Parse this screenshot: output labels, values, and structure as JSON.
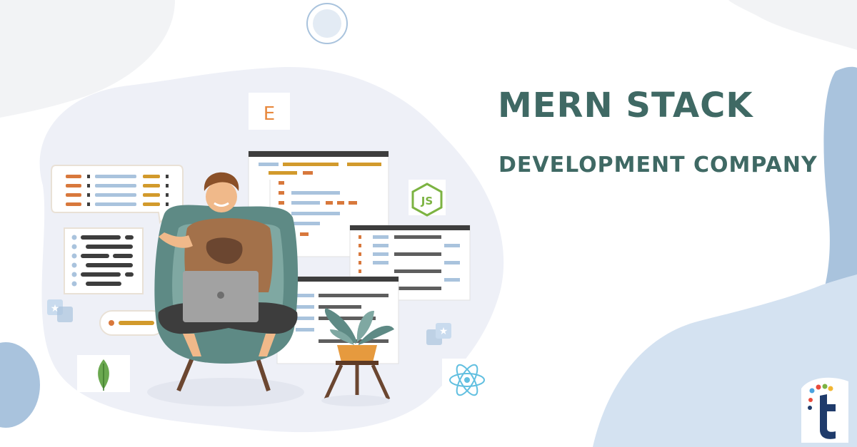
{
  "headline": {
    "title": "MERN STACK",
    "subtitle": "DEVELOPMENT COMPANY"
  },
  "tech_icons": {
    "express": "E",
    "node": "JS"
  },
  "colors": {
    "title": "#3f6964",
    "blob_light": "#eef0f7",
    "blob_blue": "#a9c3dd",
    "orange": "#d8783c",
    "gold": "#d29a2c",
    "teal_chair": "#5e8a85",
    "node_green": "#7cb342",
    "react_blue": "#61bfe0",
    "logo_navy": "#1f3b6b"
  },
  "icons": [
    "express-icon",
    "nodejs-icon",
    "mongodb-icon",
    "react-icon",
    "brand-logo",
    "star-badge-icon"
  ]
}
